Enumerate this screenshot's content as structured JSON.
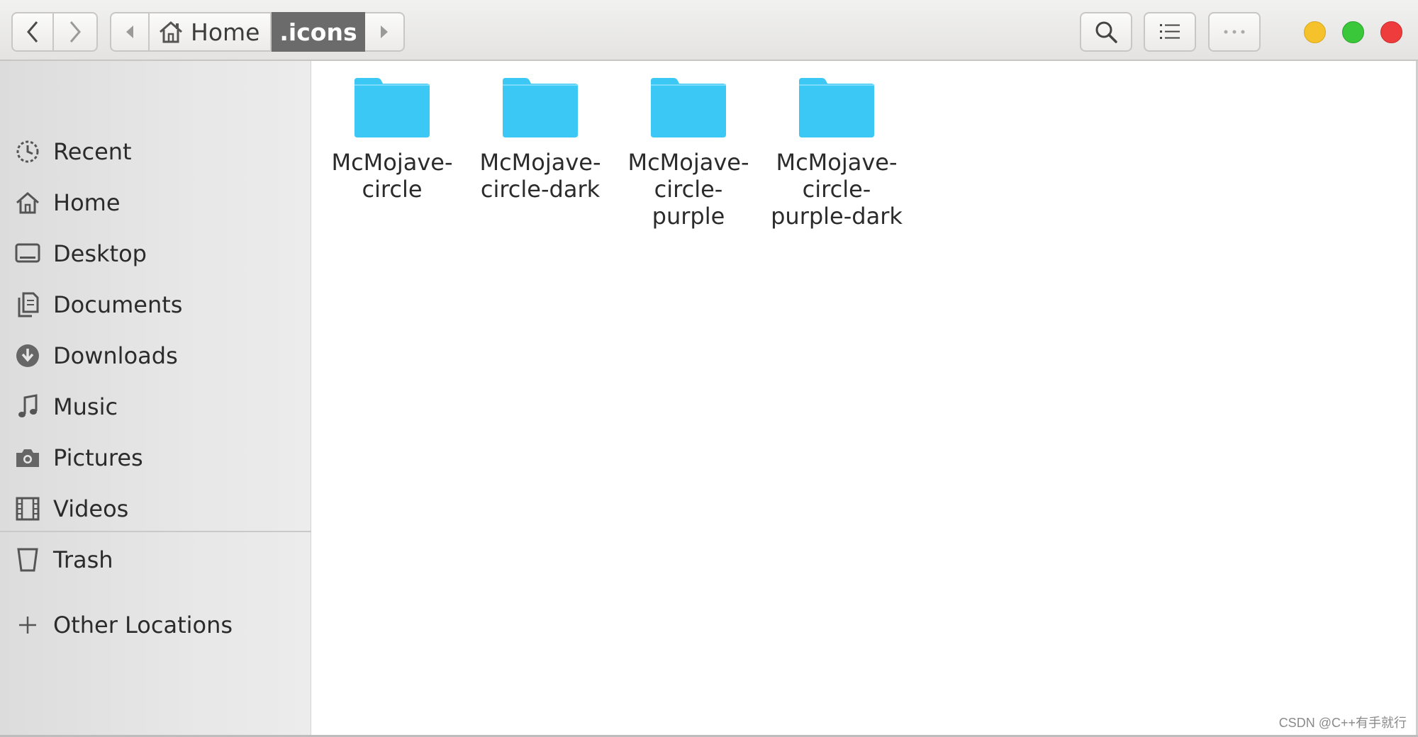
{
  "toolbar": {
    "path": [
      {
        "label": "Home",
        "icon": "home-icon"
      },
      {
        "label": ".icons",
        "active": true
      }
    ],
    "buttons": [
      "back",
      "forward",
      "search",
      "view-list",
      "more"
    ]
  },
  "window_controls": {
    "colors": {
      "minimize": "#f6c22b",
      "maximize": "#3ac83a",
      "close": "#ee3c3c"
    }
  },
  "sidebar": {
    "items": [
      {
        "label": "Recent",
        "icon": "clock-icon"
      },
      {
        "label": "Home",
        "icon": "home-icon"
      },
      {
        "label": "Desktop",
        "icon": "desktop-icon"
      },
      {
        "label": "Documents",
        "icon": "documents-icon"
      },
      {
        "label": "Downloads",
        "icon": "download-icon"
      },
      {
        "label": "Music",
        "icon": "music-note-icon"
      },
      {
        "label": "Pictures",
        "icon": "camera-icon"
      },
      {
        "label": "Videos",
        "icon": "film-icon"
      },
      {
        "label": "Trash",
        "icon": "trash-icon"
      }
    ],
    "other_locations": {
      "label": "Other Locations",
      "icon": "plus-icon"
    }
  },
  "files": [
    {
      "name": "McMojave-\ncircle",
      "type": "folder"
    },
    {
      "name": "McMojave-\ncircle-dark",
      "type": "folder"
    },
    {
      "name": "McMojave-\ncircle-\npurple",
      "type": "folder"
    },
    {
      "name": "McMojave-\ncircle-\npurple-dark",
      "type": "folder"
    }
  ],
  "colors": {
    "folder": "#3cc8f4",
    "accent_path": "#6b6b6b"
  },
  "watermark": "CSDN @C++有手就行"
}
